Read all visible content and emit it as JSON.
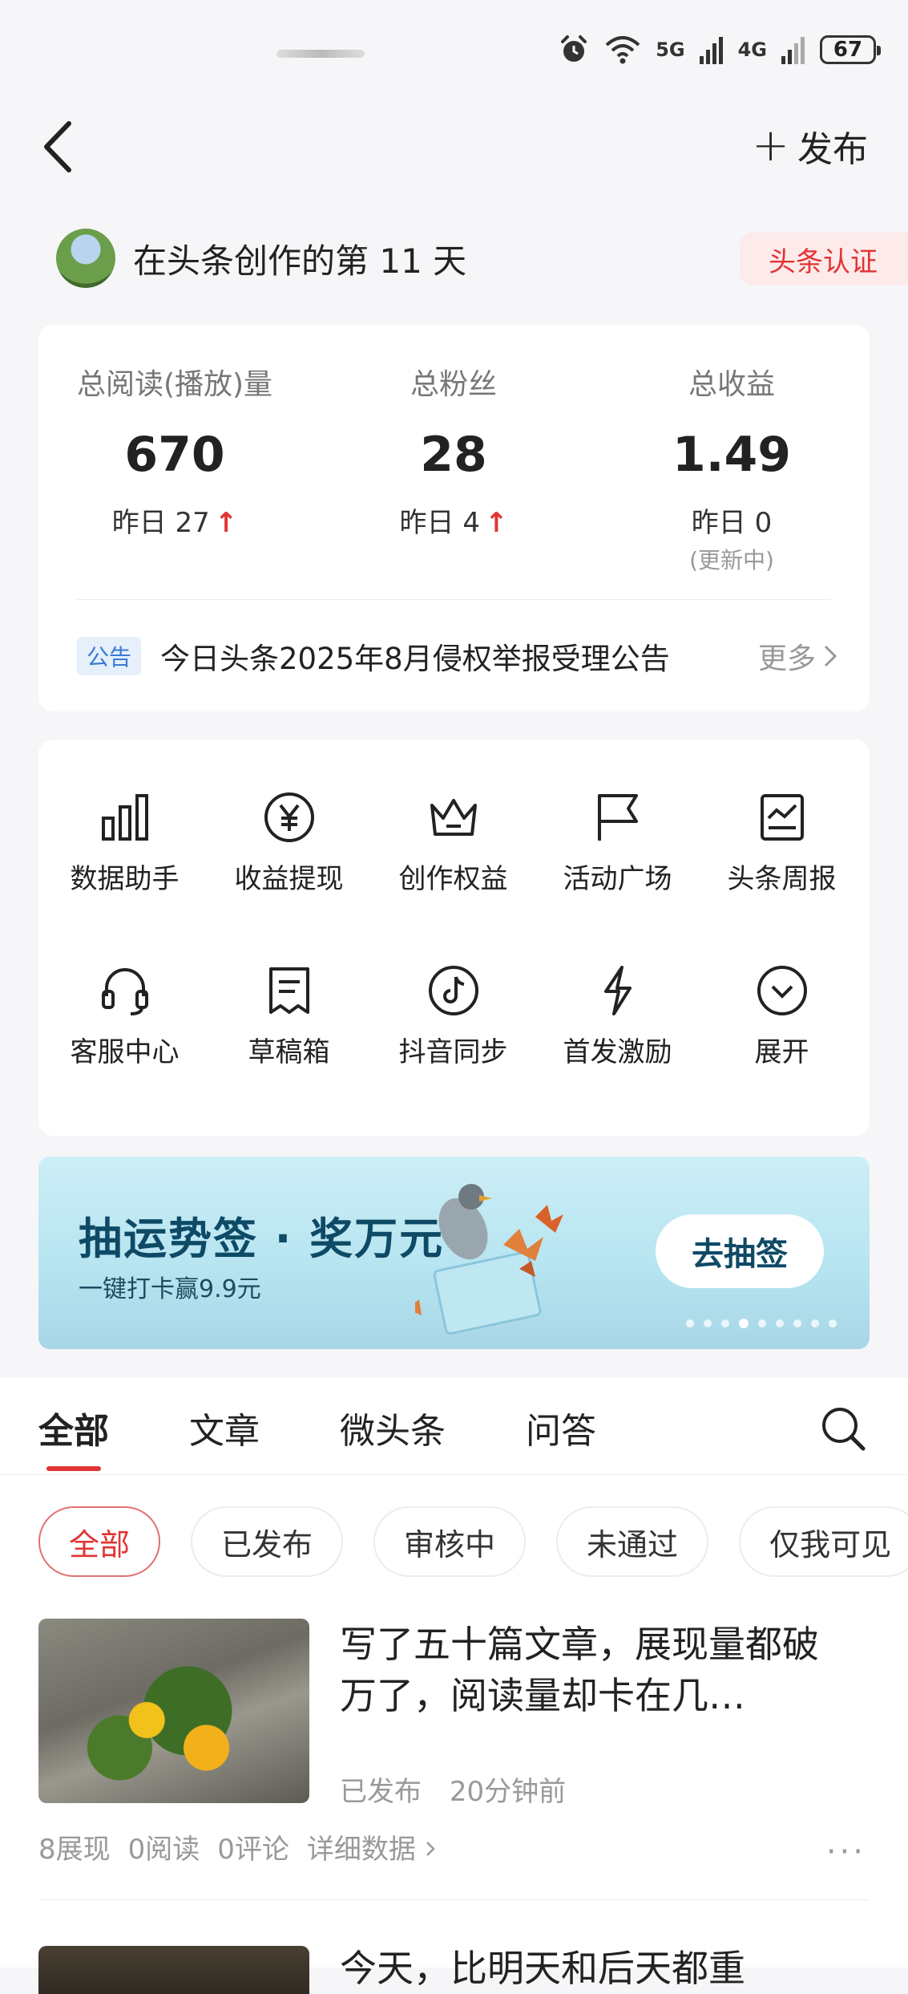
{
  "status_bar": {
    "net1": "5G",
    "net2": "4G",
    "battery": "67"
  },
  "header": {
    "publish_label": "发布"
  },
  "profile": {
    "creation_text": "在头条创作的第 11 天",
    "cert_label": "头条认证"
  },
  "stats": {
    "items": [
      {
        "label": "总阅读(播放)量",
        "value": "670",
        "yesterday": "昨日 27",
        "trend": "↑"
      },
      {
        "label": "总粉丝",
        "value": "28",
        "yesterday": "昨日 4",
        "trend": "↑"
      },
      {
        "label": "总收益",
        "value": "1.49",
        "yesterday": "昨日 0",
        "note": "(更新中)"
      }
    ],
    "notice": {
      "tag": "公告",
      "text": "今日头条2025年8月侵权举报受理公告",
      "more": "更多"
    }
  },
  "tools": [
    {
      "label": "数据助手",
      "icon": "bar-chart-icon"
    },
    {
      "label": "收益提现",
      "icon": "yen-icon"
    },
    {
      "label": "创作权益",
      "icon": "crown-icon"
    },
    {
      "label": "活动广场",
      "icon": "flag-icon"
    },
    {
      "label": "头条周报",
      "icon": "report-icon"
    },
    {
      "label": "客服中心",
      "icon": "headset-icon"
    },
    {
      "label": "草稿箱",
      "icon": "draft-icon"
    },
    {
      "label": "抖音同步",
      "icon": "douyin-icon"
    },
    {
      "label": "首发激励",
      "icon": "lightning-icon"
    },
    {
      "label": "展开",
      "icon": "expand-icon"
    }
  ],
  "banner": {
    "title": "抽运势签 · 奖万元",
    "subtitle": "一键打卡赢9.9元",
    "button": "去抽签",
    "dots_total": 9,
    "dots_active_index": 3
  },
  "content_tabs": [
    "全部",
    "文章",
    "微头条",
    "问答"
  ],
  "filter_chips": [
    "全部",
    "已发布",
    "审核中",
    "未通过",
    "仅我可见"
  ],
  "posts": [
    {
      "title": "写了五十篇文章，展现量都破万了，阅读量却卡在几…",
      "status": "已发布",
      "time": "20分钟前",
      "impressions": "8展现",
      "reads": "0阅读",
      "comments": "0评论",
      "details": "详细数据",
      "more": "···"
    },
    {
      "title": "今天，比明天和后天都重"
    }
  ],
  "colors": {
    "accent_red": "#e23434",
    "banner_text": "#0e4a66"
  }
}
